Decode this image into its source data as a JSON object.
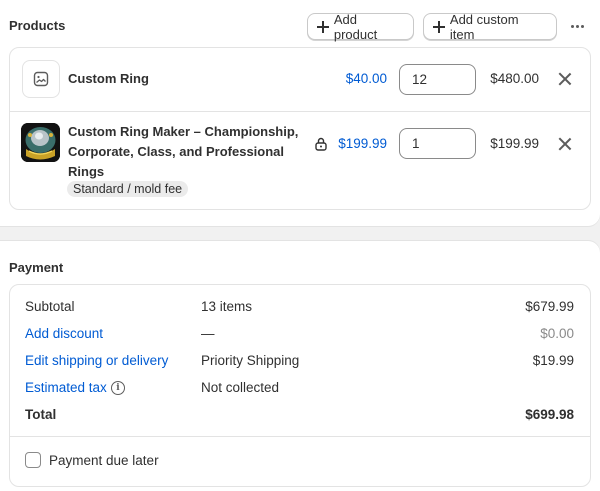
{
  "products": {
    "title": "Products",
    "add_product_label": "Add product",
    "add_custom_item_label": "Add custom item",
    "items": [
      {
        "name": "Custom Ring",
        "price": "$40.00",
        "quantity": "12",
        "total": "$480.00",
        "thumbnail": "image-placeholder-icon"
      },
      {
        "name_lines": [
          "Custom Ring Maker – Championship,",
          "Corporate, Class, and Professional",
          "Rings"
        ],
        "variant": "Standard / mold fee",
        "price": "$199.99",
        "quantity": "1",
        "total": "$199.99",
        "thumbnail": "championship-ring-photo"
      }
    ]
  },
  "payment": {
    "title": "Payment",
    "subtotal": {
      "label": "Subtotal",
      "detail": "13 items",
      "value": "$679.99"
    },
    "discount": {
      "label": "Add discount",
      "detail": "—",
      "value": "$0.00"
    },
    "shipping": {
      "label": "Edit shipping or delivery",
      "detail": "Priority Shipping",
      "value": "$19.99"
    },
    "tax": {
      "label": "Estimated tax",
      "detail": "Not collected",
      "info_icon": "info-icon"
    },
    "total": {
      "label": "Total",
      "value": "$699.98"
    },
    "due_later_label": "Payment due later"
  },
  "colors": {
    "link": "#005bd3",
    "text": "#303030",
    "muted": "#8a8a8a",
    "background": "#f1f1f1"
  }
}
